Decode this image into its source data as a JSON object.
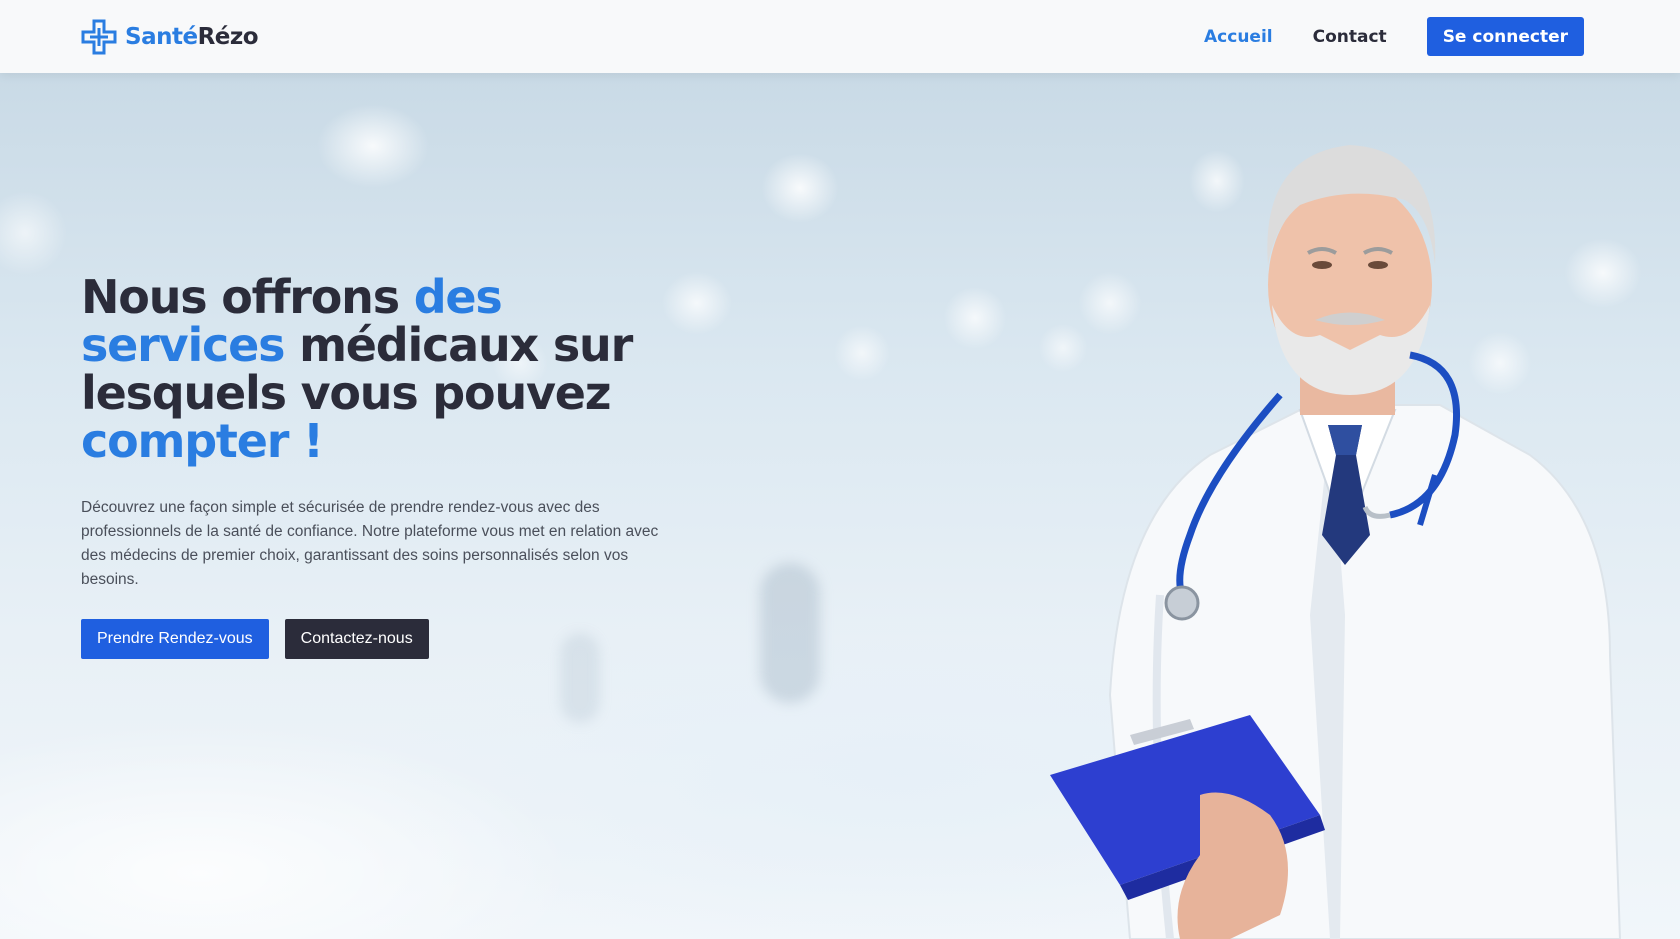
{
  "header": {
    "brand_part1": "Santé",
    "brand_part2": "Rézo",
    "logo_icon": "medical-cross-icon",
    "nav": [
      {
        "label": "Accueil",
        "active": true
      },
      {
        "label": "Contact",
        "active": false
      }
    ],
    "login_label": "Se connecter"
  },
  "hero": {
    "title_parts": [
      "Nous offrons ",
      "des",
      "services",
      " médicaux sur lesquels vous pouvez ",
      "compter !"
    ],
    "description": "Découvrez une façon simple et sécurisée de prendre rendez-vous avec des professionnels de la santé de confiance. Notre plateforme vous met en relation avec des médecins de premier choix, garantissant des soins personnalisés selon vos besoins.",
    "primary_button": "Prendre Rendez-vous",
    "secondary_button": "Contactez-nous"
  },
  "colors": {
    "accent": "#2a7de1",
    "primary_button": "#1f5fe0",
    "dark": "#2b2c3a"
  }
}
